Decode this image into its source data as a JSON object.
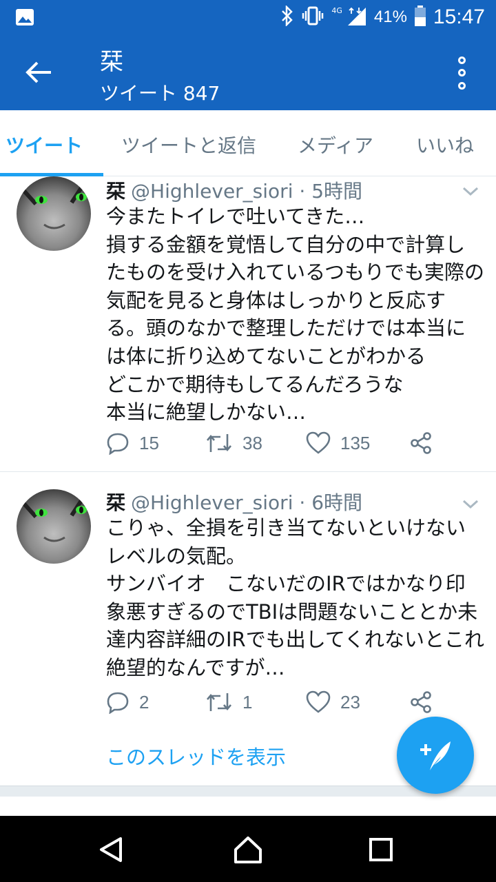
{
  "status_bar": {
    "network_label": "4G",
    "battery": "41%",
    "time": "15:47"
  },
  "app_bar": {
    "title": "栞",
    "subtitle": "ツイート 847"
  },
  "tabs": [
    {
      "label": "ツイート",
      "active": true
    },
    {
      "label": "ツイートと返信",
      "active": false
    },
    {
      "label": "メディア",
      "active": false
    },
    {
      "label": "いいね",
      "active": false
    }
  ],
  "tweets": [
    {
      "name": "栞",
      "handle": "@Highlever_siori",
      "time": "· 5時間",
      "text": "今またトイレで吐いてきた…\n損する金額を覚悟して自分の中で計算したものを受け入れているつもりでも実際の気配を見ると身体はしっかりと反応する。頭のなかで整理しただけでは本当には体に折り込めてないことがわかる\nどこかで期待もしてるんだろうな\n本当に絶望しかない…",
      "replies": "15",
      "retweets": "38",
      "likes": "135"
    },
    {
      "name": "栞",
      "handle": "@Highlever_siori",
      "time": "· 6時間",
      "text": "こりゃ、全損を引き当てないといけないレベルの気配。\nサンバイオ　こないだのIRではかなり印象悪すぎるのでTBIは問題ないこととか未達内容詳細のIRでも出してくれないとこれ絶望的なんですが…",
      "replies": "2",
      "retweets": "1",
      "likes": "23",
      "thread_link": "このスレッドを表示"
    }
  ],
  "colors": {
    "header": "#1565c0",
    "accent": "#1da1f2",
    "muted": "#657786"
  },
  "icons": [
    "back-arrow-icon",
    "overflow-menu-icon",
    "reply-icon",
    "retweet-icon",
    "like-icon",
    "share-icon",
    "chevron-down-icon",
    "compose-tweet-icon",
    "nav-back-icon",
    "nav-home-icon",
    "nav-recents-icon"
  ]
}
